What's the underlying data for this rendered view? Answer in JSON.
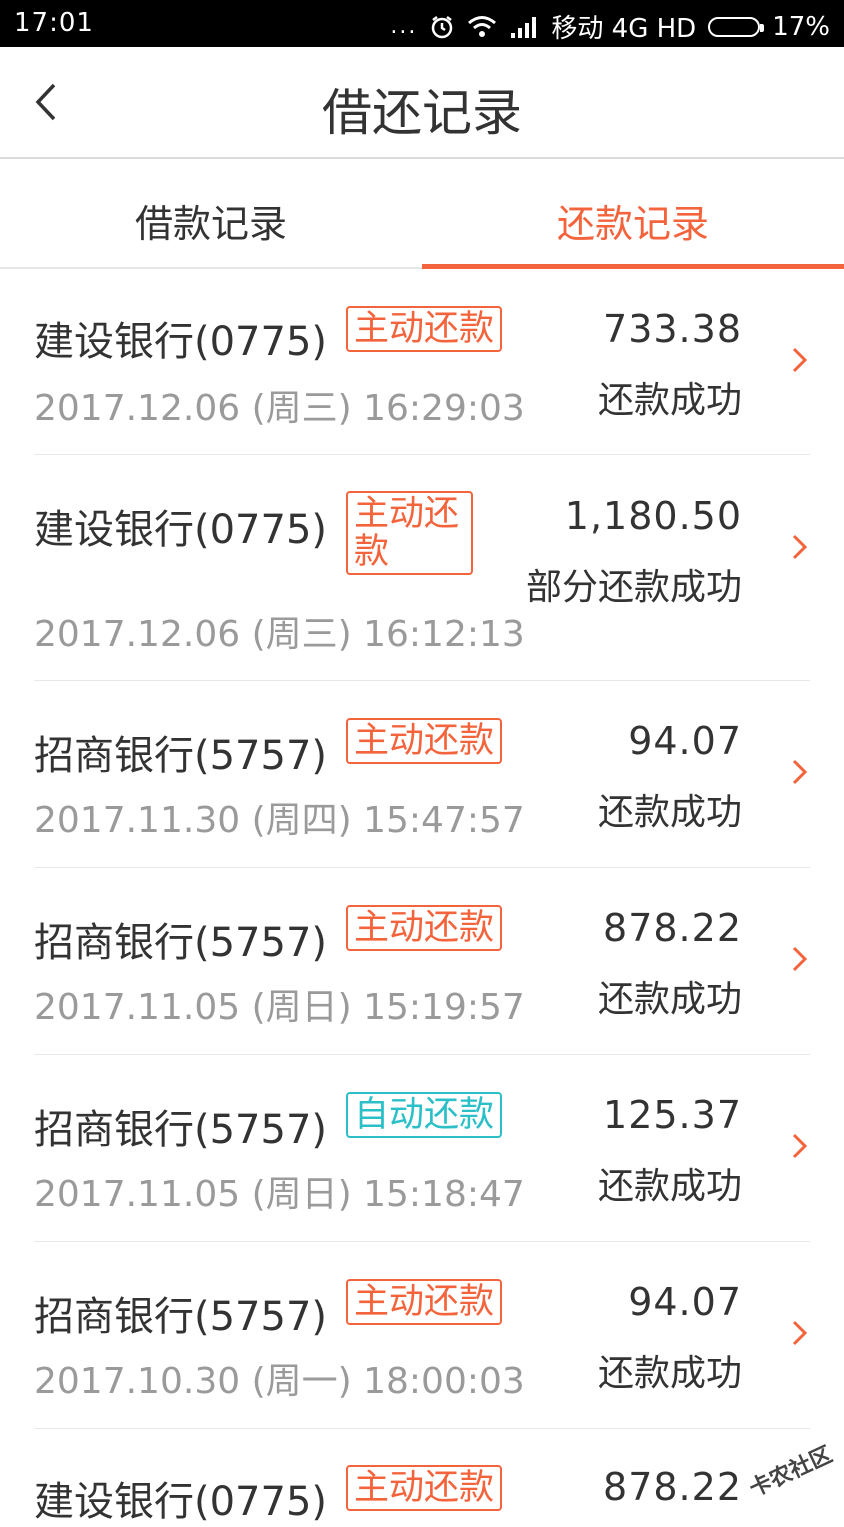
{
  "status_bar": {
    "time": "17:01",
    "dots": "...",
    "carrier": "移动 4G HD",
    "battery": "17%"
  },
  "header": {
    "title": "借还记录",
    "back_icon": "chevron-left-icon"
  },
  "tabs": [
    {
      "label": "借款记录",
      "active": false
    },
    {
      "label": "还款记录",
      "active": true
    }
  ],
  "accent_color": "#f4643c",
  "auto_color": "#2bbfc8",
  "records": [
    {
      "bank": "建设银行(0775)",
      "tag": "主动还款",
      "date": "2017.12.06 (周三) 16:29:03",
      "amount": "733.38",
      "status": "还款成功"
    },
    {
      "bank": "建设银行(0775)",
      "tag": "主动还款",
      "date": "2017.12.06 (周三) 16:12:13",
      "amount": "1,180.50",
      "status": "部分还款成功"
    },
    {
      "bank": "招商银行(5757)",
      "tag": "主动还款",
      "date": "2017.11.30 (周四) 15:47:57",
      "amount": "94.07",
      "status": "还款成功"
    },
    {
      "bank": "招商银行(5757)",
      "tag": "主动还款",
      "date": "2017.11.05 (周日) 15:19:57",
      "amount": "878.22",
      "status": "还款成功"
    },
    {
      "bank": "招商银行(5757)",
      "tag": "自动还款",
      "date": "2017.11.05 (周日) 15:18:47",
      "amount": "125.37",
      "status": "还款成功"
    },
    {
      "bank": "招商银行(5757)",
      "tag": "主动还款",
      "date": "2017.10.30 (周一) 18:00:03",
      "amount": "94.07",
      "status": "还款成功"
    },
    {
      "bank": "建设银行(0775)",
      "tag": "主动还款",
      "date": "",
      "amount": "878.22",
      "status": ""
    }
  ],
  "watermark": "卡农社区"
}
